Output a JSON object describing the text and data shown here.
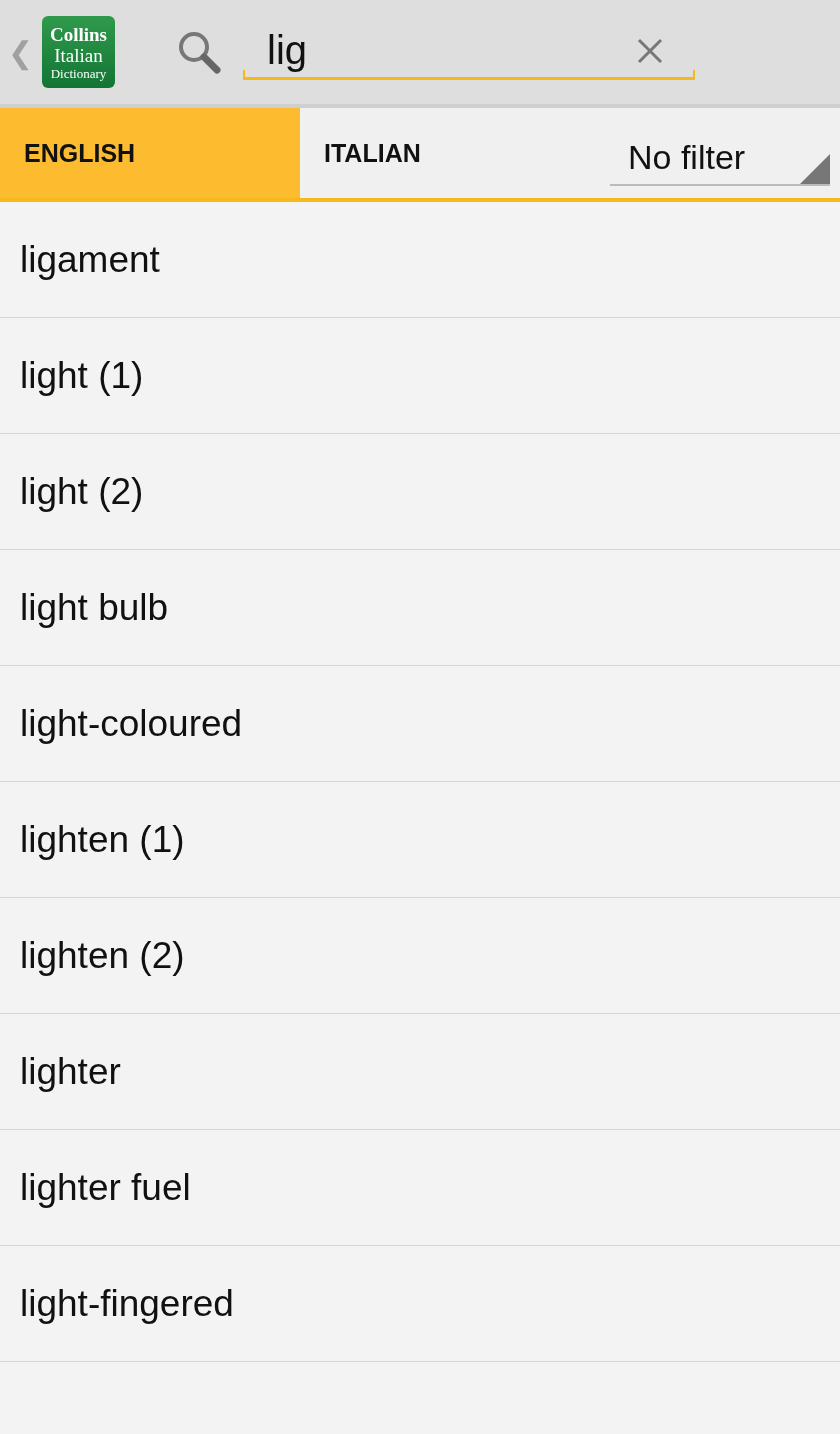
{
  "header": {
    "back": "❮",
    "logo": [
      "Collins",
      "Italian",
      "Dictionary"
    ],
    "search": {
      "value": "lig"
    }
  },
  "tabs": [
    {
      "label": "ENGLISH",
      "selected": true
    },
    {
      "label": "ITALIAN",
      "selected": false
    }
  ],
  "filter": {
    "value": "No filter"
  },
  "results": [
    "ligament",
    "light (1)",
    "light (2)",
    "light bulb",
    "light-coloured",
    "lighten (1)",
    "lighten (2)",
    "lighter",
    "lighter fuel",
    "light-fingered"
  ]
}
